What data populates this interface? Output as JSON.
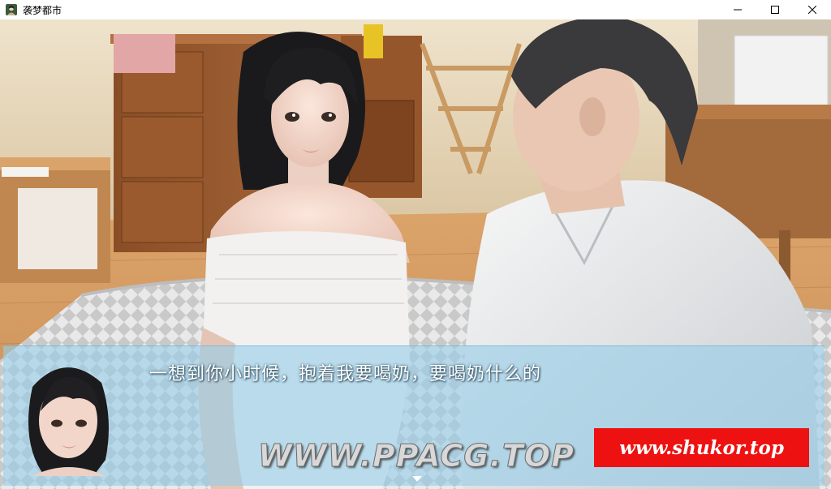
{
  "window": {
    "title": "袭梦都市",
    "controls": {
      "minimize_icon": "minimize-icon",
      "maximize_icon": "maximize-icon",
      "close_icon": "close-icon"
    }
  },
  "dialogue": {
    "text": "一想到你小时候，抱着我要喝奶，要喝奶什么的",
    "continue_icon": "continue-arrow-icon"
  },
  "watermarks": {
    "ppacg": "WWW.PPACG.TOP",
    "shukor": "www.shukor.top"
  },
  "colors": {
    "dialogue_box": "#96cde8",
    "shukor_badge": "#ee1111",
    "titlebar": "#ffffff"
  }
}
